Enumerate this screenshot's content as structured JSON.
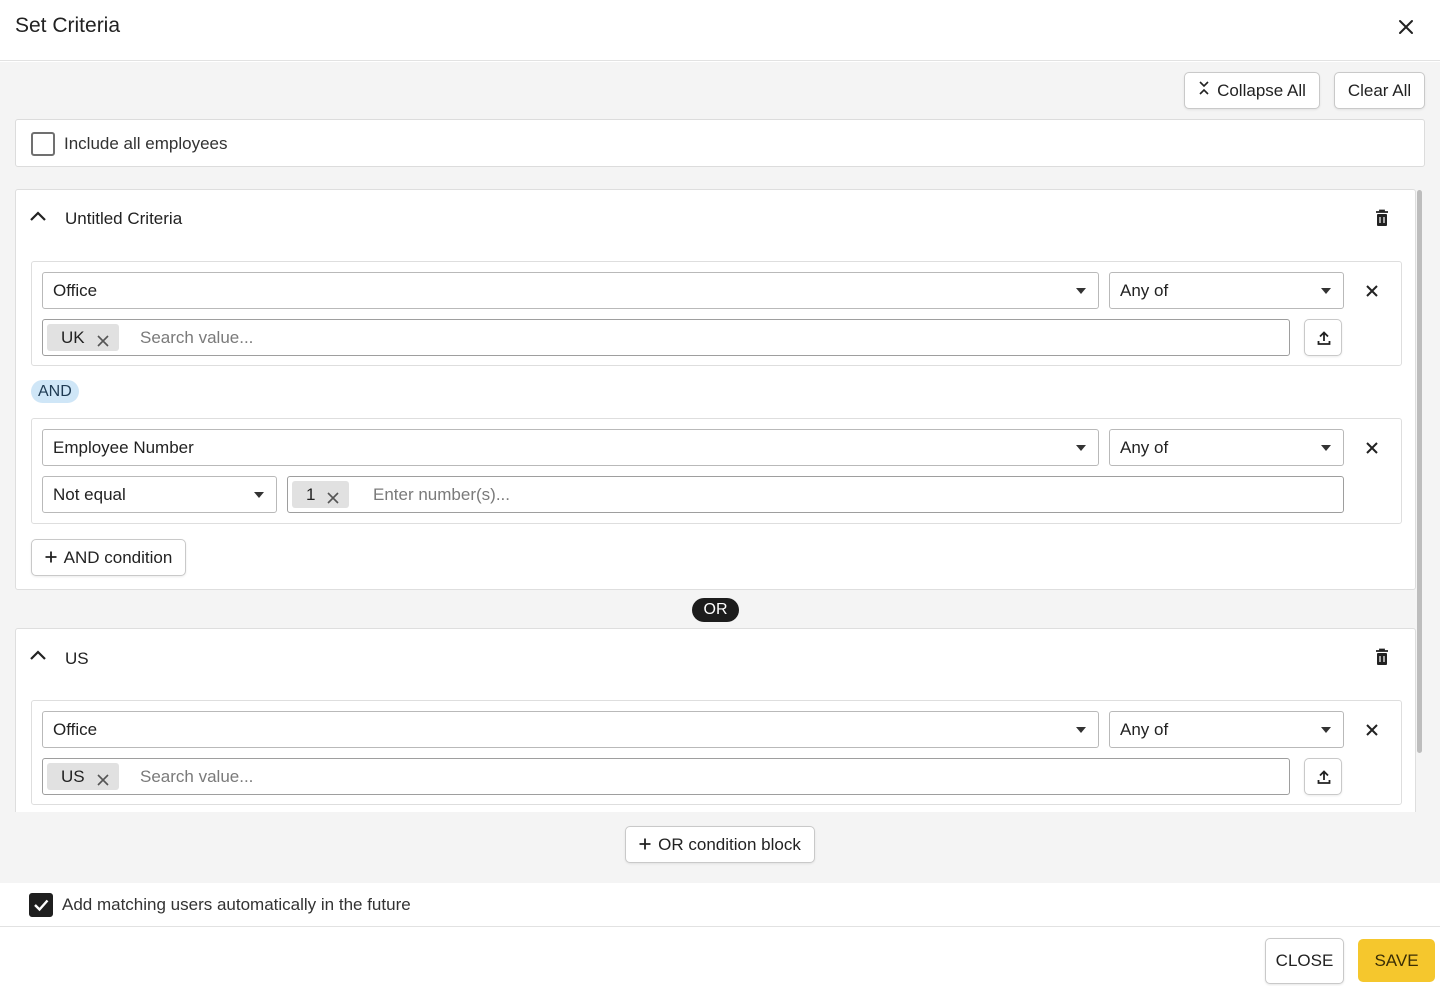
{
  "dialog": {
    "title": "Set Criteria"
  },
  "toolbar": {
    "collapse_all_label": "Collapse All",
    "clear_all_label": "Clear All"
  },
  "include_all": {
    "label": "Include all employees",
    "checked": false
  },
  "criteria_blocks": [
    {
      "title": "Untitled Criteria",
      "conditions": [
        {
          "field": "Office",
          "match": "Any of",
          "values": [
            "UK"
          ],
          "placeholder": "Search value..."
        },
        {
          "field": "Employee Number",
          "match": "Any of",
          "operator": "Not equal",
          "values": [
            "1"
          ],
          "placeholder": "Enter number(s)..."
        }
      ],
      "and_label": "AND",
      "add_and_label": "AND condition"
    },
    {
      "title": "US",
      "conditions": [
        {
          "field": "Office",
          "match": "Any of",
          "values": [
            "US"
          ],
          "placeholder": "Search value..."
        }
      ]
    }
  ],
  "or_label": "OR",
  "add_or_block_label": "OR condition block",
  "auto_add": {
    "label": "Add matching users automatically in the future",
    "checked": true
  },
  "actions": {
    "close_label": "CLOSE",
    "save_label": "SAVE"
  },
  "colors": {
    "save_button": "#f5c72d",
    "and_pill": "#cfe6f7",
    "or_pill": "#1c1c1c",
    "panel_background": "#f4f4f4"
  }
}
